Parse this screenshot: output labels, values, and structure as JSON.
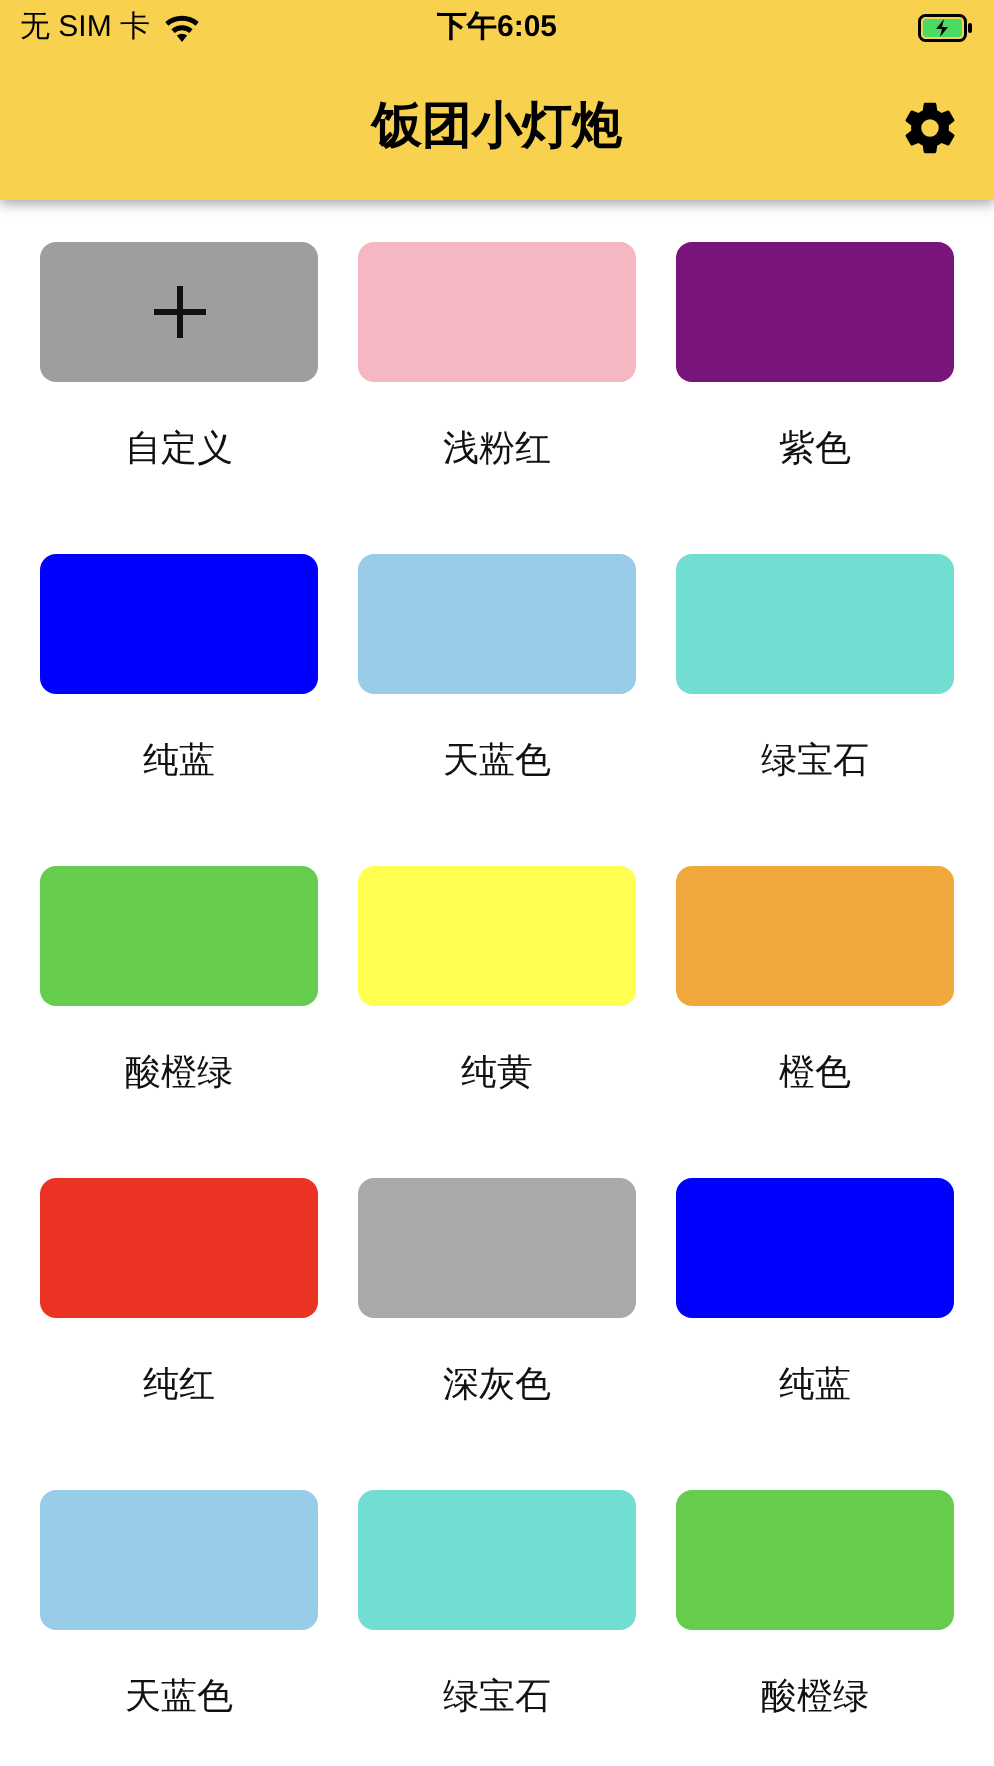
{
  "status_bar": {
    "carrier": "无 SIM 卡",
    "time": "下午6:05"
  },
  "header": {
    "title": "饭团小灯炮"
  },
  "swatches": [
    {
      "kind": "custom",
      "label": "自定义"
    },
    {
      "kind": "color",
      "label": "浅粉红",
      "color": "#f5b8c2"
    },
    {
      "kind": "color",
      "label": "紫色",
      "color": "#78147a"
    },
    {
      "kind": "color",
      "label": "纯蓝",
      "color": "#0000ff"
    },
    {
      "kind": "color",
      "label": "天蓝色",
      "color": "#99cce8"
    },
    {
      "kind": "color",
      "label": "绿宝石",
      "color": "#72ddd1"
    },
    {
      "kind": "color",
      "label": "酸橙绿",
      "color": "#66cc4d"
    },
    {
      "kind": "color",
      "label": "纯黄",
      "color": "#ffff52"
    },
    {
      "kind": "color",
      "label": "橙色",
      "color": "#f0a83c"
    },
    {
      "kind": "color",
      "label": "纯红",
      "color": "#eb3323"
    },
    {
      "kind": "color",
      "label": "深灰色",
      "color": "#a9a9a9"
    },
    {
      "kind": "color",
      "label": "纯蓝",
      "color": "#0000ff"
    },
    {
      "kind": "color",
      "label": "天蓝色",
      "color": "#99cce8"
    },
    {
      "kind": "color",
      "label": "绿宝石",
      "color": "#72ddd1"
    },
    {
      "kind": "color",
      "label": "酸橙绿",
      "color": "#66cc4d"
    }
  ]
}
